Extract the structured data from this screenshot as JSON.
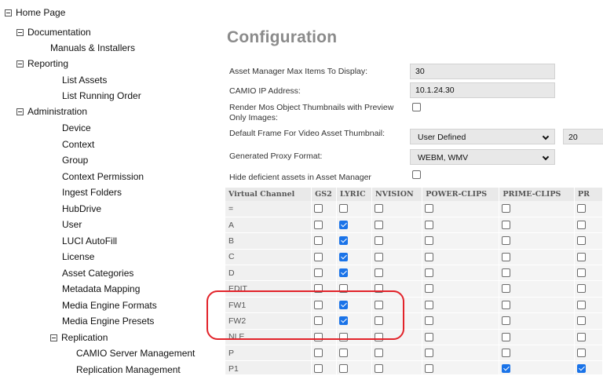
{
  "tree": {
    "home": "Home Page",
    "documentation": "Documentation",
    "manuals": "Manuals & Installers",
    "reporting": "Reporting",
    "list_assets": "List Assets",
    "list_running_order": "List Running Order",
    "administration": "Administration",
    "admin_items": [
      "Device",
      "Context",
      "Group",
      "Context Permission",
      "Ingest Folders",
      "HubDrive",
      "User",
      "LUCI AutoFill",
      "License",
      "Asset Categories",
      "Metadata Mapping",
      "Media Engine Formats",
      "Media Engine Presets"
    ],
    "replication": "Replication",
    "replication_items": [
      "CAMIO Server Management",
      "Replication Management"
    ]
  },
  "config": {
    "title": "Configuration",
    "max_items_label": "Asset Manager Max Items To Display:",
    "max_items_value": "30",
    "camio_ip_label": "CAMIO IP Address:",
    "camio_ip_value": "10.1.24.30",
    "render_mos_label": "Render Mos Object Thumbnails with Preview Only Images:",
    "default_frame_label": "Default Frame For Video Asset Thumbnail:",
    "default_frame_value": "User Defined",
    "default_frame_number": "20",
    "proxy_format_label": "Generated Proxy Format:",
    "proxy_format_value": "WEBM, WMV",
    "hide_deficient_label": "Hide deficient assets in Asset Manager"
  },
  "grid": {
    "headers": [
      "Virtual Channel",
      "GS2",
      "LYRIC",
      "NVISION",
      "POWER-CLIPS",
      "PRIME-CLIPS",
      "PR"
    ],
    "rows": [
      {
        "channel": "=",
        "checks": [
          false,
          false,
          false,
          false,
          false,
          false
        ]
      },
      {
        "channel": "A",
        "checks": [
          false,
          true,
          false,
          false,
          false,
          false
        ]
      },
      {
        "channel": "B",
        "checks": [
          false,
          true,
          false,
          false,
          false,
          false
        ]
      },
      {
        "channel": "C",
        "checks": [
          false,
          true,
          false,
          false,
          false,
          false
        ]
      },
      {
        "channel": "D",
        "checks": [
          false,
          true,
          false,
          false,
          false,
          false
        ]
      },
      {
        "channel": "EDIT",
        "checks": [
          false,
          false,
          false,
          false,
          false,
          false
        ]
      },
      {
        "channel": "FW1",
        "checks": [
          false,
          true,
          false,
          false,
          false,
          false
        ]
      },
      {
        "channel": "FW2",
        "checks": [
          false,
          true,
          false,
          false,
          false,
          false
        ]
      },
      {
        "channel": "NLE",
        "checks": [
          false,
          false,
          false,
          false,
          false,
          false
        ]
      },
      {
        "channel": "P",
        "checks": [
          false,
          false,
          false,
          false,
          false,
          false
        ]
      },
      {
        "channel": "P1",
        "checks": [
          false,
          false,
          false,
          false,
          true,
          true
        ]
      }
    ]
  },
  "colors": {
    "accent_check": "#1a73e8",
    "highlight": "#e2232a",
    "title_gray": "#8b8b8b"
  }
}
